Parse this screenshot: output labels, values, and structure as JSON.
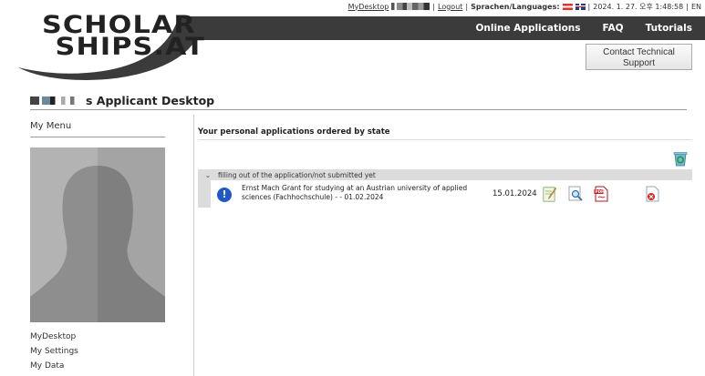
{
  "topbar": {
    "mydesktop_link": "MyDesktop",
    "logout_link": "Logout",
    "languages_label": "Sprachen/Languages:",
    "datetime": "2024. 1. 27. 오후 1:48:58",
    "lang_code": "EN"
  },
  "logo": {
    "line1": "SCHOLAR",
    "line2": "SHIPS.AT"
  },
  "nav": {
    "online_applications": "Online Applications",
    "faq": "FAQ",
    "tutorials": "Tutorials"
  },
  "support_button": {
    "line1": "Contact Technical",
    "line2": "Support"
  },
  "page_title": "s Applicant Desktop",
  "sidebar": {
    "menu_title": "My Menu",
    "links": [
      "MyDesktop",
      "My Settings",
      "My Data"
    ]
  },
  "main": {
    "section_title": "Your personal applications ordered by state",
    "group_label": "filling out of the application/not submitted yet",
    "application": {
      "title": "Ernst Mach Grant for studying at an Austrian university of applied sciences (Fachhochschule) - - 01.02.2024",
      "date": "15.01.2024"
    }
  },
  "icons": {
    "warning": "warning-icon",
    "edit": "edit-icon",
    "view": "view-icon",
    "pdf": "pdf-icon",
    "delete": "delete-icon",
    "recycle": "recycle-bin-icon"
  },
  "colors": {
    "header_band": "#3b3b3b",
    "warning_blue": "#1f58c9",
    "group_gray": "#dcdcdc"
  }
}
